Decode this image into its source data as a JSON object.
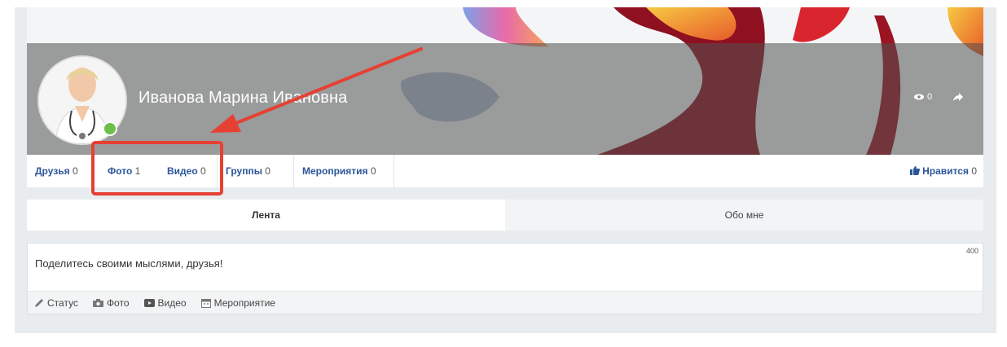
{
  "profile": {
    "name": "Иванова Марина Ивановна",
    "views_count": "0"
  },
  "tabs": [
    {
      "label": "Друзья",
      "count": "0"
    },
    {
      "label": "Фото",
      "count": "1"
    },
    {
      "label": "Видео",
      "count": "0"
    },
    {
      "label": "Группы",
      "count": "0"
    },
    {
      "label": "Мероприятия",
      "count": "0"
    }
  ],
  "likes": {
    "label": "Нравится",
    "count": "0"
  },
  "subtabs": {
    "feed": "Лента",
    "about": "Обо мне"
  },
  "post": {
    "placeholder": "Поделитесь своими мыслями, друзья!",
    "char_limit": "400",
    "actions": [
      "Статус",
      "Фото",
      "Видео",
      "Мероприятие"
    ]
  },
  "colors": {
    "link": "#2a5599",
    "annotation": "#e64033",
    "online": "#6cc04a"
  },
  "icons": [
    "eye-icon",
    "share-icon",
    "thumbs-up-icon",
    "pencil-icon",
    "camera-icon",
    "video-icon",
    "calendar-icon"
  ]
}
